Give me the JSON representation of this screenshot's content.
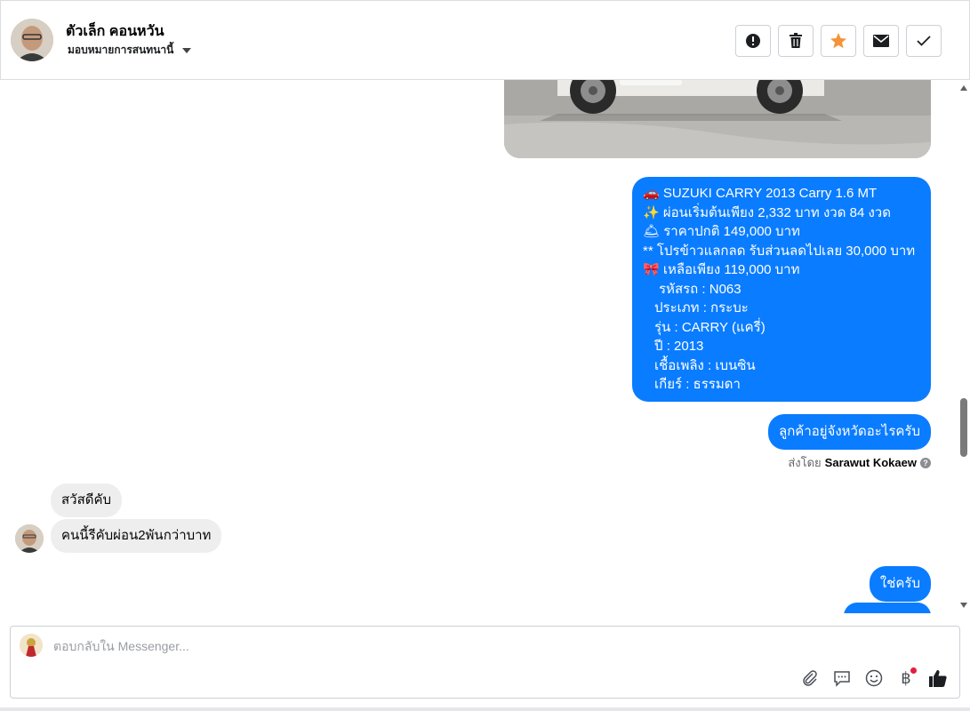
{
  "header": {
    "contact_name": "ตัวเล็ก คอนหวัน",
    "assign_label": "มอบหมายการสนทนานี้",
    "actions": [
      {
        "name": "report-button",
        "icon": "exclamation-icon"
      },
      {
        "name": "delete-button",
        "icon": "trash-icon"
      },
      {
        "name": "star-button",
        "icon": "star-icon"
      },
      {
        "name": "mark-unread-button",
        "icon": "envelope-icon"
      },
      {
        "name": "mark-done-button",
        "icon": "check-icon"
      }
    ]
  },
  "messages": {
    "listing": {
      "line1": "🚗 SUZUKI CARRY 2013 Carry 1.6 MT",
      "line2": "✨ ผ่อนเริ่มต้นเพียง 2,332 บาท งวด 84 งวด",
      "line3": "🛎 ราคาปกติ 149,000 บาท",
      "line4": "** โปรข้าวแลกลด รับส่วนลดไปเลย 30,000 บาท",
      "line5": "🎀 เหลือเพียง 119,000 บาท",
      "line6": "รหัสรถ : N063",
      "line7": "ประเภท : กระบะ",
      "line8": "รุ่น : CARRY (แครี่)",
      "line9": "ปี : 2013",
      "line10": "เชื้อเพลิง : เบนซิน",
      "line11": "เกียร์ : ธรรมดา"
    },
    "ask_province": "ลูกค้าอยู่จังหวัดอะไรครับ",
    "sent_by_prefix": "ส่งโดย",
    "sent_by_name": "Sarawut Kokaew",
    "incoming_1": "สวัสดีคับ",
    "incoming_2": "คนนี้รีคับผ่อน2พันกว่าบาท",
    "reply_yes": "ใช่ครับ"
  },
  "composer": {
    "placeholder": "ตอบกลับใน Messenger...",
    "tools": [
      "paperclip-icon",
      "speech-bubble-icon",
      "smiley-icon",
      "baht-icon",
      "thumbs-up-icon"
    ]
  },
  "colors": {
    "outgoing_bubble": "#0a7cff",
    "incoming_bubble": "#eeeeee",
    "star": "#f5933a"
  }
}
